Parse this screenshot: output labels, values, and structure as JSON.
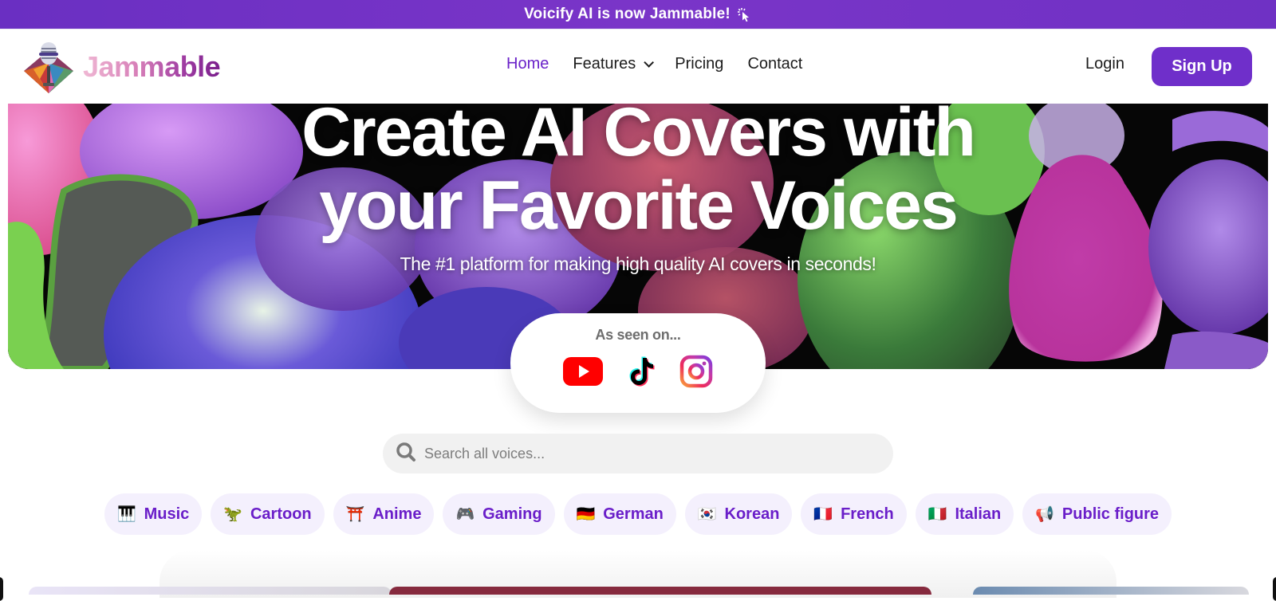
{
  "announcement": {
    "text": "Voicify AI is now Jammable!",
    "icon": "cursor-click-icon"
  },
  "header": {
    "brand": "Jammable",
    "logo_icon": "microphone-diamond-logo",
    "nav": [
      {
        "label": "Home",
        "active": true
      },
      {
        "label": "Features",
        "has_dropdown": true
      },
      {
        "label": "Pricing"
      },
      {
        "label": "Contact"
      }
    ],
    "login_label": "Login",
    "signup_label": "Sign Up"
  },
  "hero": {
    "title_line1": "Create AI Covers with",
    "title_line2": "your Favorite Voices",
    "subtitle": "The #1 platform for making high quality AI covers in seconds!"
  },
  "as_seen_on": {
    "label": "As seen on...",
    "platforms": [
      {
        "name": "YouTube",
        "icon": "youtube-icon"
      },
      {
        "name": "TikTok",
        "icon": "tiktok-icon"
      },
      {
        "name": "Instagram",
        "icon": "instagram-icon"
      }
    ]
  },
  "search": {
    "placeholder": "Search all voices...",
    "value": ""
  },
  "categories": [
    {
      "emoji": "🎹",
      "label": "Music",
      "icon": "piano-icon"
    },
    {
      "emoji": "🦖",
      "label": "Cartoon",
      "icon": "dinosaur-icon"
    },
    {
      "emoji": "⛩️",
      "label": "Anime",
      "icon": "torii-gate-icon"
    },
    {
      "emoji": "🎮",
      "label": "Gaming",
      "icon": "game-controller-icon"
    },
    {
      "emoji": "🇩🇪",
      "label": "German",
      "icon": "germany-flag-icon"
    },
    {
      "emoji": "🇰🇷",
      "label": "Korean",
      "icon": "korea-flag-icon"
    },
    {
      "emoji": "🇫🇷",
      "label": "French",
      "icon": "france-flag-icon"
    },
    {
      "emoji": "🇮🇹",
      "label": "Italian",
      "icon": "italy-flag-icon"
    },
    {
      "emoji": "📢",
      "label": "Public figure",
      "icon": "megaphone-icon"
    }
  ],
  "colors": {
    "brand_purple": "#6f2fca",
    "chip_bg": "#f4f0fd",
    "chip_text": "#6a1ec9",
    "active_nav": "#6a22c9"
  }
}
